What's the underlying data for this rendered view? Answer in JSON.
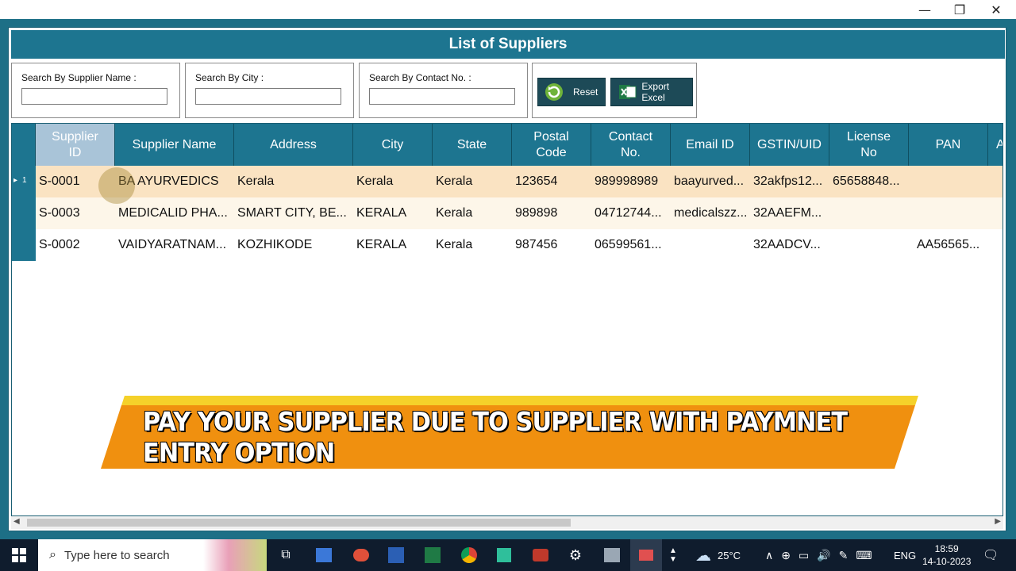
{
  "window": {
    "title": "List of Suppliers",
    "controls": [
      "—",
      "❐",
      "✕"
    ]
  },
  "search": {
    "supplier_name_label": "Search By Supplier Name :",
    "city_label": "Search By City :",
    "contact_label": "Search By Contact No. :",
    "supplier_name_value": "",
    "city_value": "",
    "contact_value": ""
  },
  "buttons": {
    "reset": "Reset",
    "export": "Export Excel"
  },
  "table": {
    "columns": [
      "Supplier\nID",
      "Supplier Name",
      "Address",
      "City",
      "State",
      "Postal\nCode",
      "Contact\nNo.",
      "Email ID",
      "GSTIN/UID",
      "License\nNo",
      "PAN",
      "A"
    ],
    "rows": [
      {
        "row_number": "1",
        "cells": [
          "S-0001",
          "BA AYURVEDICS",
          "Kerala",
          "Kerala",
          "Kerala",
          "123654",
          "989998989",
          "baayurved...",
          "32akfps12...",
          "65658848...",
          "",
          ""
        ]
      },
      {
        "row_number": "",
        "cells": [
          "S-0003",
          "MEDICALID PHA...",
          "SMART CITY, BE...",
          "KERALA",
          "Kerala",
          "989898",
          "04712744...",
          "medicalszz...",
          "32AAEFM...",
          "",
          "",
          ""
        ]
      },
      {
        "row_number": "",
        "cells": [
          "S-0002",
          "VAIDYARATNAM...",
          "KOZHIKODE",
          "KERALA",
          "Kerala",
          "987456",
          "06599561...",
          "",
          "32AADCV...",
          "",
          "AA56565...",
          ""
        ]
      }
    ],
    "selected_row_color": "#fae3c2",
    "alt_row_color": "#fdf6e9"
  },
  "banner": {
    "text": "PAY YOUR SUPPLIER DUE TO SUPPLIER WITH PAYMNET ENTRY OPTION"
  },
  "taskbar": {
    "search_placeholder": "Type here to search",
    "weather": "25°C",
    "language": "ENG",
    "time": "18:59",
    "date": "14-10-2023"
  }
}
